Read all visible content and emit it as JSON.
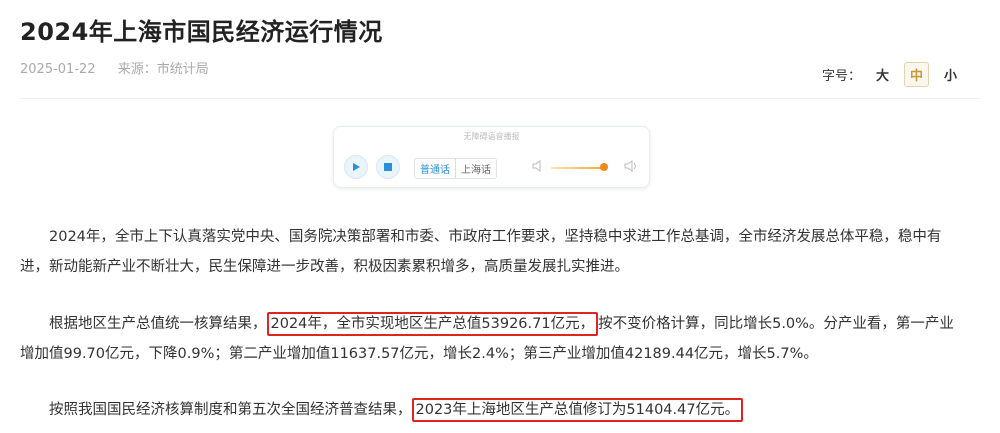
{
  "article": {
    "title": "2024年上海市国民经济运行情况",
    "date": "2025-01-22",
    "source": "来源：市统计局"
  },
  "font_size": {
    "label": "字号：",
    "options": [
      "大",
      "中",
      "小"
    ],
    "selected": "中"
  },
  "player": {
    "caption": "无障碍语音播报",
    "languages": [
      "普通话",
      "上海话"
    ],
    "selected_language": "普通话",
    "volume_level": 0.88,
    "accent_color": "#2a8fd8",
    "volume_color": "#f08a1c"
  },
  "paragraphs": {
    "p1": "2024年，全市上下认真落实党中央、国务院决策部署和市委、市政府工作要求，坚持稳中求进工作总基调，全市经济发展总体平稳，稳中有进，新动能新产业不断壮大，民生保障进一步改善，积极因素累积增多，高质量发展扎实推进。",
    "p2_before": "根据地区生产总值统一核算结果，",
    "p2_highlight": "2024年，全市实现地区生产总值53926.71亿元，",
    "p2_after": "按不变价格计算，同比增长5.0%。分产业看，第一产业增加值99.70亿元，下降0.9%；第二产业增加值11637.57亿元，增长2.4%；第三产业增加值42189.44亿元，增长5.7%。",
    "p3_before": "按照我国国民经济核算制度和第五次全国经济普查结果，",
    "p3_highlight": "2023年上海地区生产总值修订为51404.47亿元。"
  },
  "highlight_color": "#e02424"
}
